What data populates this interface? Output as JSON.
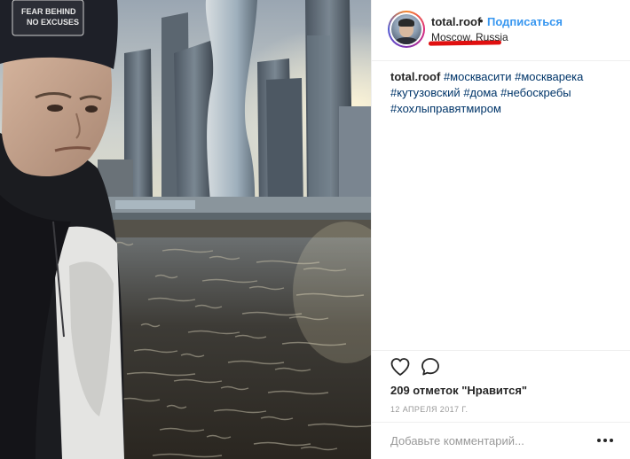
{
  "photo": {
    "cap_lines": [
      "FEAR BEHIND",
      "NO EXCUSES"
    ]
  },
  "post": {
    "username": "total.roof",
    "separator": "•",
    "follow_label": "Подписаться",
    "location": "Moscow, Russia"
  },
  "caption": {
    "username": "total.roof",
    "hashtags": [
      "#москвасити",
      "#москварека",
      "#кутузовский",
      "#дома",
      "#небоскребы",
      "#хохлыправятмиром"
    ]
  },
  "actions": {
    "like_icon": "heart-icon",
    "comment_icon": "speech-bubble-icon"
  },
  "likes": {
    "text": "209 отметок \"Нравится\""
  },
  "date": {
    "text": "12 АПРЕЛЯ 2017 Г."
  },
  "comment": {
    "placeholder": "Добавьте комментарий...",
    "more_icon": "ellipsis-icon"
  },
  "colors": {
    "link": "#3897f0",
    "hashtag": "#003569",
    "highlight": "#e01010"
  }
}
